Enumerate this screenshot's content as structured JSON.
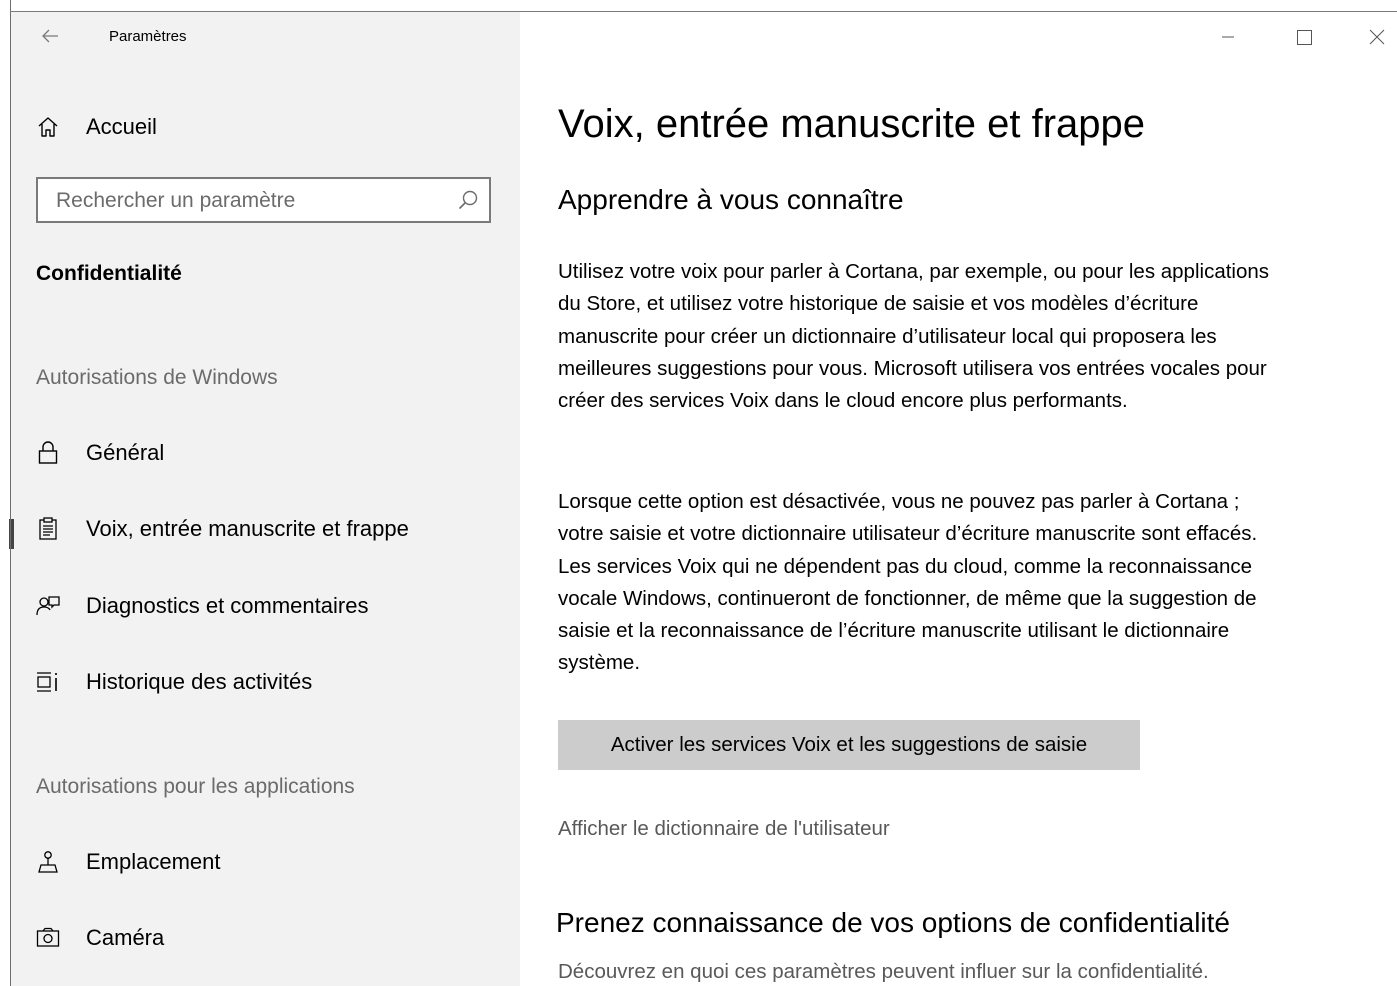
{
  "window": {
    "title": "Paramètres"
  },
  "sidebar": {
    "home_label": "Accueil",
    "search": {
      "placeholder": "Rechercher un paramètre"
    },
    "category": "Confidentialité",
    "groups": [
      {
        "label": "Autorisations de Windows",
        "items": [
          {
            "label": "Général",
            "icon": "lock-icon"
          },
          {
            "label": "Voix, entrée manuscrite et frappe",
            "icon": "clipboard-icon",
            "selected": true
          },
          {
            "label": "Diagnostics et commentaires",
            "icon": "feedback-icon"
          },
          {
            "label": "Historique des activités",
            "icon": "timeline-icon"
          }
        ]
      },
      {
        "label": "Autorisations pour les applications",
        "items": [
          {
            "label": "Emplacement",
            "icon": "location-icon"
          },
          {
            "label": "Caméra",
            "icon": "camera-icon"
          }
        ]
      }
    ]
  },
  "main": {
    "title": "Voix, entrée manuscrite et frappe",
    "section_title": "Apprendre à vous connaître",
    "paragraph_1": "Utilisez votre voix pour parler à Cortana, par exemple, ou pour les applications du Store, et utilisez votre historique de saisie et vos modèles d’écriture manuscrite pour créer un dictionnaire d’utilisateur local qui proposera les meilleures suggestions pour vous. Microsoft utilisera vos entrées vocales pour créer des services Voix dans le cloud encore plus performants.",
    "paragraph_2": "Lorsque cette option est désactivée, vous ne pouvez pas parler à Cortana ; votre saisie et votre dictionnaire utilisateur d’écriture manuscrite sont effacés. Les services Voix qui ne dépendent pas du cloud, comme la reconnaissance vocale Windows, continueront de fonctionner, de même que la suggestion de saisie et la reconnaissance de l’écriture manuscrite utilisant le dictionnaire système.",
    "button_label": "Activer les services Voix et les suggestions de saisie",
    "link_label": "Afficher le dictionnaire de l'utilisateur",
    "privacy_title": "Prenez connaissance de vos options de confidentialité",
    "privacy_text": "Découvrez en quoi ces paramètres peuvent influer sur la confidentialité."
  },
  "colors": {
    "sidebar_bg": "#f2f2f2",
    "button_bg": "#cccccc",
    "muted_text": "#6b6b6b"
  }
}
